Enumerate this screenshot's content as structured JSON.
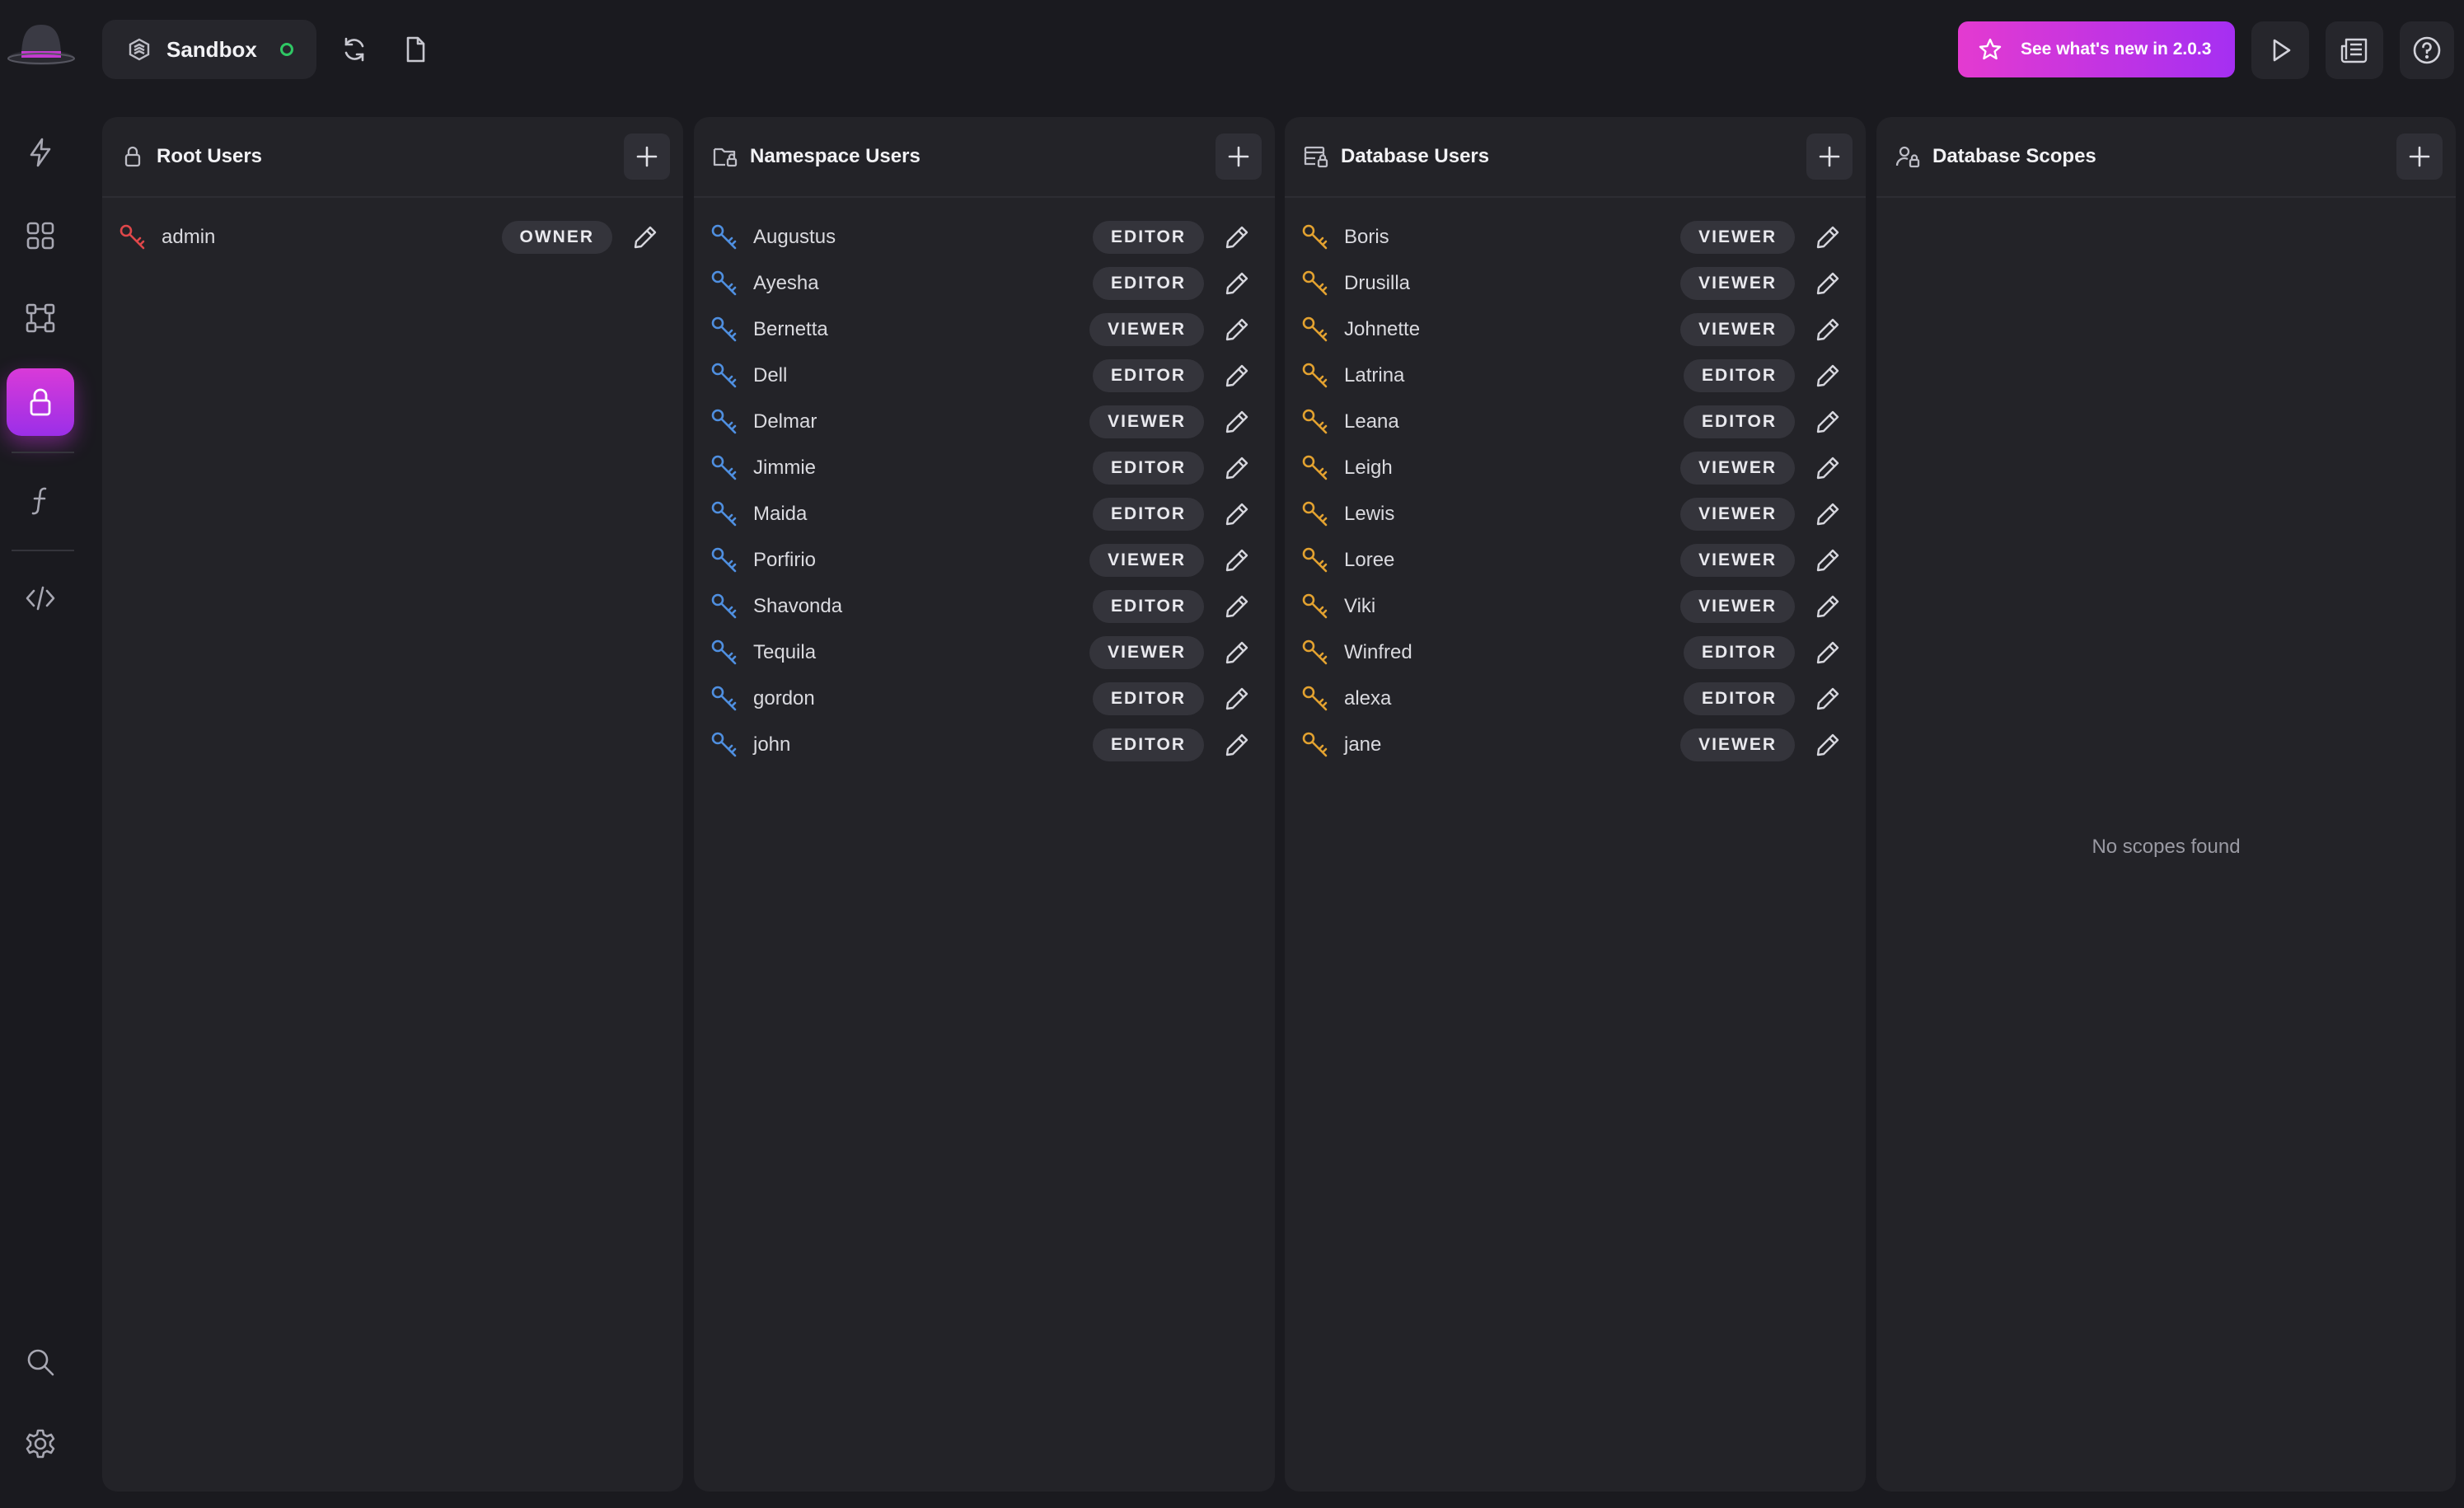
{
  "header": {
    "namespace_label": "Sandbox",
    "news_label": "See what's new in 2.0.3"
  },
  "panels": {
    "root": {
      "title": "Root Users",
      "users": [
        {
          "name": "admin",
          "role": "OWNER"
        }
      ]
    },
    "namespace": {
      "title": "Namespace Users",
      "users": [
        {
          "name": "Augustus",
          "role": "EDITOR"
        },
        {
          "name": "Ayesha",
          "role": "EDITOR"
        },
        {
          "name": "Bernetta",
          "role": "VIEWER"
        },
        {
          "name": "Dell",
          "role": "EDITOR"
        },
        {
          "name": "Delmar",
          "role": "VIEWER"
        },
        {
          "name": "Jimmie",
          "role": "EDITOR"
        },
        {
          "name": "Maida",
          "role": "EDITOR"
        },
        {
          "name": "Porfirio",
          "role": "VIEWER"
        },
        {
          "name": "Shavonda",
          "role": "EDITOR"
        },
        {
          "name": "Tequila",
          "role": "VIEWER"
        },
        {
          "name": "gordon",
          "role": "EDITOR"
        },
        {
          "name": "john",
          "role": "EDITOR"
        }
      ]
    },
    "database": {
      "title": "Database Users",
      "users": [
        {
          "name": "Boris",
          "role": "VIEWER"
        },
        {
          "name": "Drusilla",
          "role": "VIEWER"
        },
        {
          "name": "Johnette",
          "role": "VIEWER"
        },
        {
          "name": "Latrina",
          "role": "EDITOR"
        },
        {
          "name": "Leana",
          "role": "EDITOR"
        },
        {
          "name": "Leigh",
          "role": "VIEWER"
        },
        {
          "name": "Lewis",
          "role": "VIEWER"
        },
        {
          "name": "Loree",
          "role": "VIEWER"
        },
        {
          "name": "Viki",
          "role": "VIEWER"
        },
        {
          "name": "Winfred",
          "role": "EDITOR"
        },
        {
          "name": "alexa",
          "role": "EDITOR"
        },
        {
          "name": "jane",
          "role": "VIEWER"
        }
      ]
    },
    "scopes": {
      "title": "Database Scopes",
      "empty_message": "No scopes found"
    }
  },
  "colors": {
    "root_key": "#e0474a",
    "namespace_key": "#4f8fe0",
    "database_key": "#e3a230",
    "accent_start": "#e43ad0",
    "accent_end": "#a52ff2",
    "status_online": "#2fc764"
  },
  "icons": {
    "sidebar": [
      "bolt-icon",
      "grid-icon",
      "graph-icon",
      "lock-icon",
      "function-icon",
      "code-icon",
      "search-icon",
      "gear-icon"
    ],
    "header": [
      "namespace-icon",
      "refresh-icon",
      "file-icon",
      "star-icon",
      "play-icon",
      "news-icon",
      "help-icon"
    ]
  }
}
